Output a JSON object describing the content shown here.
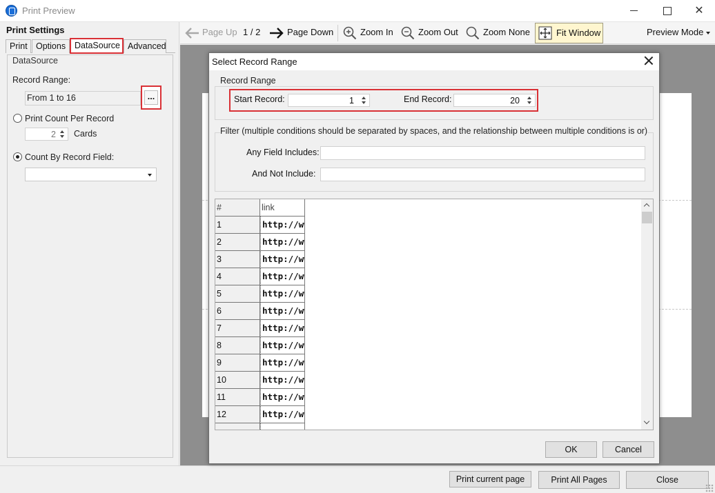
{
  "window": {
    "title": "Print Preview"
  },
  "settings": {
    "title": "Print Settings",
    "tabs": [
      "Print",
      "Options",
      "DataSource",
      "Advanced"
    ],
    "active_tab": "DataSource",
    "group_label": "DataSource",
    "record_range_label": "Record Range:",
    "record_range_value": "From 1 to 16",
    "browse_label": "...",
    "print_count_label": "Print Count Per Record",
    "print_count_value": "2",
    "cards_label": "Cards",
    "count_by_field_label": "Count By Record Field:",
    "count_by_field_value": ""
  },
  "toolbar": {
    "page_up": "Page Up",
    "page_indicator": "1 / 2",
    "page_down": "Page Down",
    "zoom_in": "Zoom In",
    "zoom_out": "Zoom Out",
    "zoom_none": "Zoom None",
    "fit_window": "Fit Window",
    "preview_mode": "Preview Mode"
  },
  "bottom": {
    "print_current": "Print current page",
    "print_all": "Print All Pages",
    "close": "Close"
  },
  "dialog": {
    "title": "Select Record Range",
    "range_group": "Record Range",
    "start_label": "Start Record:",
    "start_value": "1",
    "end_label": "End Record:",
    "end_value": "20",
    "filter_group": "Filter (multiple conditions should be separated by spaces, and the relationship between multiple conditions is or)",
    "any_includes_label": "Any Field Includes:",
    "any_includes_value": "",
    "not_include_label": "And Not Include:",
    "not_include_value": "",
    "grid": {
      "headers": [
        "#",
        "link"
      ],
      "rows": [
        {
          "num": "1",
          "link": "http://ww"
        },
        {
          "num": "2",
          "link": "http://ww"
        },
        {
          "num": "3",
          "link": "http://ww"
        },
        {
          "num": "4",
          "link": "http://ww"
        },
        {
          "num": "5",
          "link": "http://ww"
        },
        {
          "num": "6",
          "link": "http://ww"
        },
        {
          "num": "7",
          "link": "http://ww"
        },
        {
          "num": "8",
          "link": "http://ww"
        },
        {
          "num": "9",
          "link": "http://ww"
        },
        {
          "num": "10",
          "link": "http://ww"
        },
        {
          "num": "11",
          "link": "http://ww"
        },
        {
          "num": "12",
          "link": "http://ww"
        }
      ]
    },
    "ok": "OK",
    "cancel": "Cancel"
  },
  "colors": {
    "highlight": "#d93035",
    "fit_active": "#fff6cf",
    "preview_bg": "#8e8e8e"
  }
}
